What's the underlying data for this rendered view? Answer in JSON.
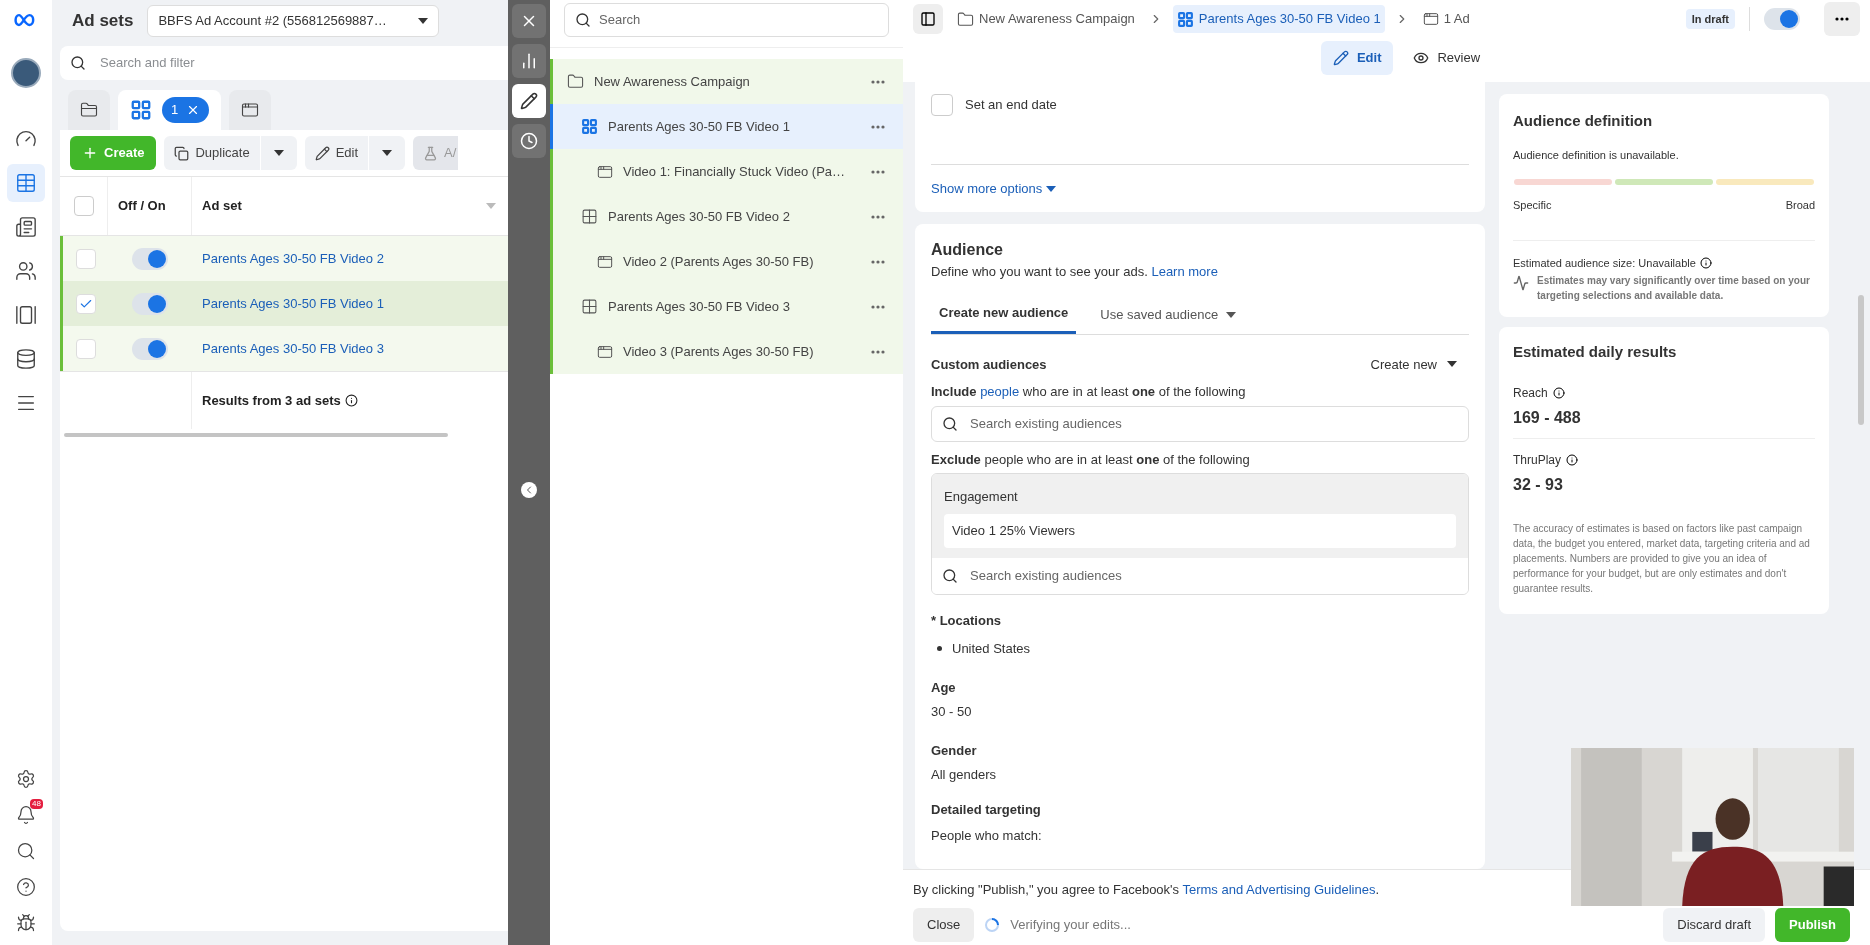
{
  "nav": {
    "items": [
      {
        "kind": "dashboard",
        "selected": false
      },
      {
        "kind": "table",
        "selected": true
      },
      {
        "kind": "pages",
        "selected": false
      },
      {
        "kind": "audiences",
        "selected": false
      },
      {
        "kind": "creative",
        "selected": false
      },
      {
        "kind": "billing",
        "selected": false
      },
      {
        "kind": "menu",
        "selected": false
      }
    ],
    "bottom": [
      {
        "kind": "settings"
      },
      {
        "kind": "notifications",
        "badge": "48"
      },
      {
        "kind": "search"
      },
      {
        "kind": "help"
      },
      {
        "kind": "bug"
      }
    ]
  },
  "ad_sets_panel": {
    "title": "Ad sets",
    "account": "BBFS Ad Account #2 (556812569887…",
    "search": {
      "placeholder": "Search and filter"
    },
    "view_tabs": [
      {
        "kind": "campaigns",
        "selected": false
      },
      {
        "kind": "ad_sets",
        "selected": true,
        "count": "1"
      },
      {
        "kind": "ads",
        "selected": false
      }
    ],
    "select_all": {
      "checked": false
    },
    "toolbar": {
      "create": "Create",
      "duplicate": "Duplicate",
      "edit": "Edit",
      "test": "A/"
    },
    "table": {
      "columns": [
        "Off / On",
        "Ad set"
      ],
      "rows": [
        {
          "name": "Parents Ages 30-50 FB Video 2",
          "checked": false,
          "on": true
        },
        {
          "name": "Parents Ages 30-50 FB Video 1",
          "checked": true,
          "on": true
        },
        {
          "name": "Parents Ages 30-50 FB Video 3",
          "checked": false,
          "on": true
        }
      ],
      "footer": "Results from 3 ad sets"
    }
  },
  "tree_panel": {
    "search": {
      "placeholder": "Search"
    },
    "items": [
      {
        "kind": "campaign",
        "label": "New Awareness Campaign",
        "selected": false,
        "children": [
          {
            "kind": "ad_set",
            "label": "Parents Ages 30-50 FB Video 1",
            "selected": true,
            "children": [
              {
                "kind": "ad",
                "label": "Video 1: Financially Stuck Video (Pa…",
                "selected": false
              }
            ]
          },
          {
            "kind": "ad_set",
            "label": "Parents Ages 30-50 FB Video 2",
            "selected": false,
            "children": [
              {
                "kind": "ad",
                "label": "Video 2 (Parents Ages 30-50 FB)",
                "selected": false
              }
            ]
          },
          {
            "kind": "ad_set",
            "label": "Parents Ages 30-50 FB Video 3",
            "selected": false,
            "children": [
              {
                "kind": "ad",
                "label": "Video 3 (Parents Ages 30-50 FB)",
                "selected": false
              }
            ]
          }
        ]
      }
    ]
  },
  "editor": {
    "breadcrumb": [
      {
        "kind": "campaign",
        "label": "New Awareness Campaign",
        "selected": false
      },
      {
        "kind": "ad_set",
        "label": "Parents Ages 30-50 FB Video 1",
        "selected": true
      },
      {
        "kind": "ad",
        "label": "1 Ad",
        "selected": false
      }
    ],
    "status": "In draft",
    "on": true,
    "mode_tabs": [
      {
        "kind": "edit",
        "label": "Edit",
        "selected": true
      },
      {
        "kind": "review",
        "label": "Review",
        "selected": false
      }
    ],
    "end_date": {
      "label": "Set an end date",
      "checked": false
    },
    "show_more": "Show more options",
    "audience": {
      "title": "Audience",
      "description": "Define who you want to see your ads.",
      "link": "Learn more",
      "tabs": [
        {
          "label": "Create new audience",
          "selected": true,
          "dropdown": false
        },
        {
          "label": "Use saved audience",
          "selected": false,
          "dropdown": true
        }
      ],
      "custom_audiences": {
        "label": "Custom audiences",
        "create_new": "Create new",
        "include": {
          "lead": "Include",
          "link": "people",
          "rest": "who are in at least **one** of the following",
          "placeholder": "Search existing audiences"
        },
        "exclude": {
          "text": "**Exclude** people who are in at least **one** of the following",
          "group": "Engagement",
          "items": [
            "Video 1 25% Viewers"
          ],
          "placeholder": "Search existing audiences"
        }
      },
      "locations": {
        "label": "* Locations",
        "items": [
          "United States"
        ]
      },
      "age": {
        "label": "Age",
        "value": "30 - 50"
      },
      "gender": {
        "label": "Gender",
        "value": "All genders"
      },
      "detailed_targeting": {
        "label": "Detailed targeting",
        "value": "People who match:"
      }
    }
  },
  "sidebar": {
    "definition": {
      "title": "Audience definition",
      "text": "Audience definition is unavailable.",
      "low": "Specific",
      "high": "Broad",
      "size": "Estimated audience size: Unavailable",
      "note": "Estimates may vary significantly over time based on your targeting selections and available data."
    },
    "results": {
      "title": "Estimated daily results",
      "metrics": [
        {
          "label": "Reach",
          "value": "169 - 488"
        },
        {
          "label": "ThruPlay",
          "value": "32 - 93"
        }
      ],
      "note": "The accuracy of estimates is based on factors like past campaign data, the budget you entered, market data, targeting criteria and ad placements. Numbers are provided to give you an idea of performance for your budget, but are only estimates and don't guarantee results."
    }
  },
  "footer": {
    "consent": "By clicking \"Publish,\" you agree to Facebook's",
    "link": "Terms and Advertising Guidelines",
    "end": ".",
    "close": "Close",
    "status": "Verifying your edits...",
    "discard": "Discard draft",
    "publish": "Publish"
  }
}
